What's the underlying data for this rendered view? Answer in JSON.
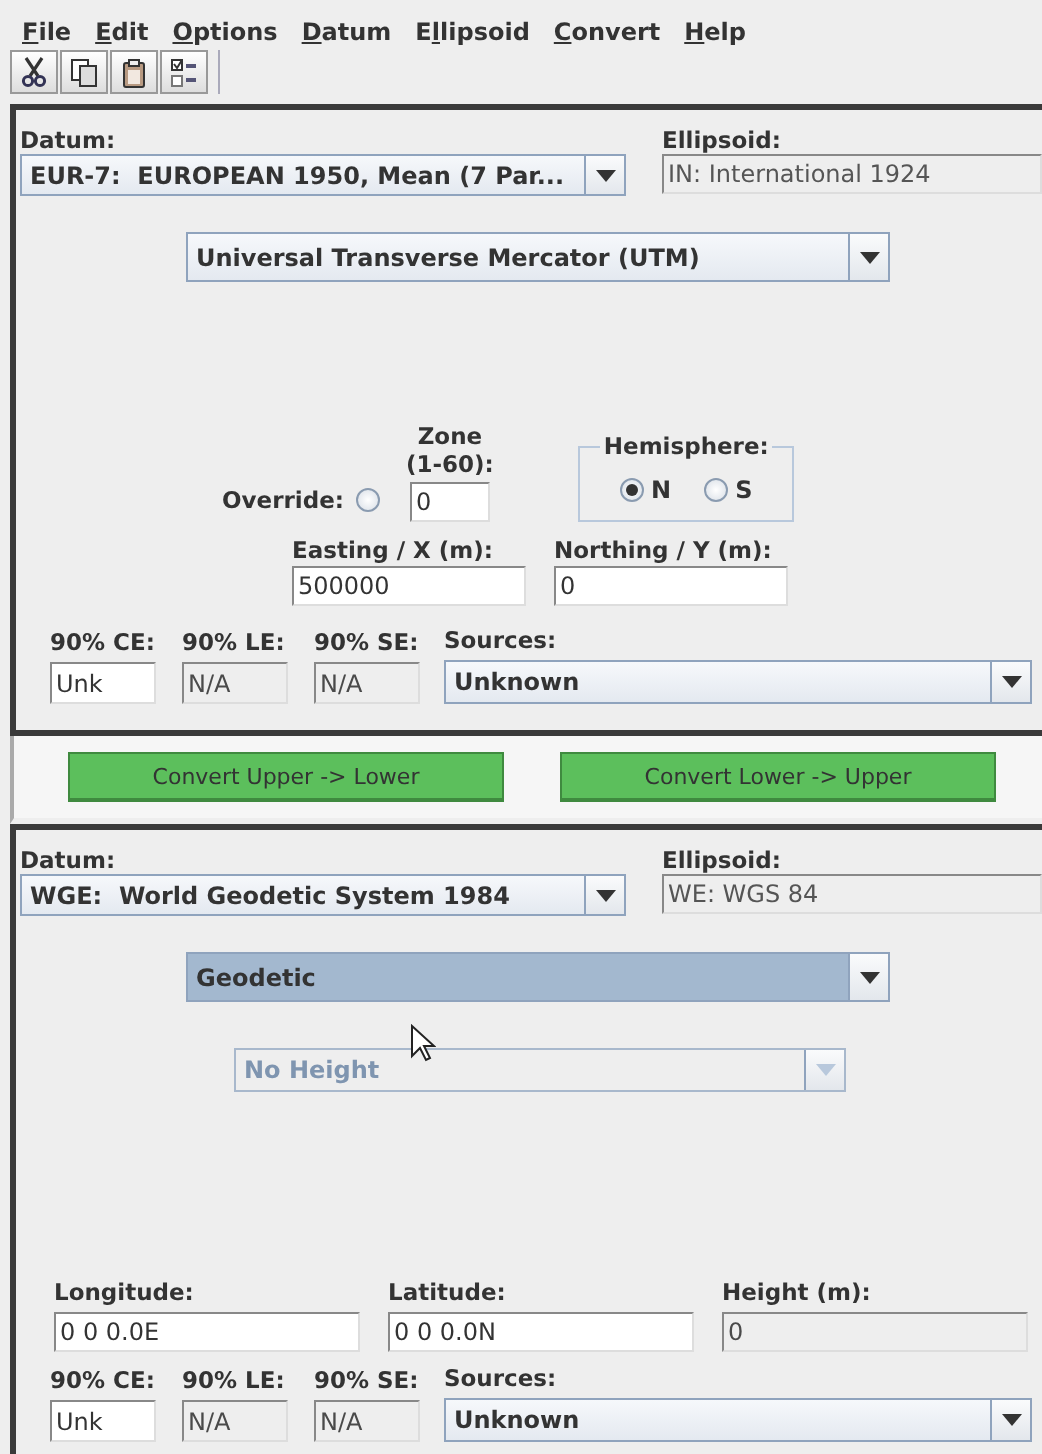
{
  "menu": [
    {
      "key": "F",
      "post": "ile"
    },
    {
      "key": "E",
      "post": "dit"
    },
    {
      "key": "O",
      "post": "ptions"
    },
    {
      "key": "D",
      "post": "atum"
    },
    {
      "pre": "E",
      "key": "l",
      "post": "lipsoid"
    },
    {
      "key": "C",
      "post": "onvert"
    },
    {
      "key": "H",
      "post": "elp"
    }
  ],
  "toolbar": [
    {
      "kind": "cut"
    },
    {
      "kind": "copy"
    },
    {
      "kind": "paste"
    },
    {
      "kind": "options"
    }
  ],
  "upper": {
    "datum_label": "Datum:",
    "datum": "EUR-7:  EUROPEAN 1950, Mean (7 Par...",
    "ellipsoid_label": "Ellipsoid:",
    "ellipsoid": "IN:  International 1924",
    "projection": {
      "value": "Universal Transverse Mercator (UTM)",
      "selected": false
    },
    "override": {
      "label": "Override:",
      "checked": false
    },
    "zone": {
      "label_lines": [
        "Zone",
        "(1-60):"
      ],
      "value": "0"
    },
    "hemisphere": {
      "title": "Hemisphere:",
      "options": [
        {
          "label": "N",
          "selected": true
        },
        {
          "label": "S",
          "selected": false
        }
      ]
    },
    "coordinates": [
      {
        "label": "Easting / X (m):",
        "value": "500000",
        "disabled": false
      },
      {
        "label": "Northing / Y (m):",
        "value": "0",
        "disabled": false
      }
    ],
    "accuracy": [
      {
        "label": "90% CE:",
        "value": "Unk",
        "disabled": false
      },
      {
        "label": "90% LE:",
        "value": "N/A",
        "disabled": true
      },
      {
        "label": "90% SE:",
        "value": "N/A",
        "disabled": true
      }
    ],
    "sources": {
      "label": "Sources:",
      "value": "Unknown"
    }
  },
  "buttons": [
    "Convert Upper -> Lower",
    "Convert Lower -> Upper"
  ],
  "lower": {
    "datum_label": "Datum:",
    "datum": "WGE:  World Geodetic System 1984",
    "ellipsoid_label": "Ellipsoid:",
    "ellipsoid": "WE:  WGS 84",
    "projection": {
      "value": "Geodetic",
      "selected": true
    },
    "height_type": {
      "value": "No Height",
      "disabled": true
    },
    "coordinates": [
      {
        "label": "Longitude:",
        "value": "0 0 0.0E",
        "disabled": false
      },
      {
        "label": "Latitude:",
        "value": "0 0 0.0N",
        "disabled": false
      },
      {
        "label": "Height (m):",
        "value": "0",
        "disabled": true
      }
    ],
    "accuracy": [
      {
        "label": "90% CE:",
        "value": "Unk",
        "disabled": false
      },
      {
        "label": "90% LE:",
        "value": "N/A",
        "disabled": true
      },
      {
        "label": "90% SE:",
        "value": "N/A",
        "disabled": true
      }
    ],
    "sources": {
      "label": "Sources:",
      "value": "Unknown"
    }
  }
}
